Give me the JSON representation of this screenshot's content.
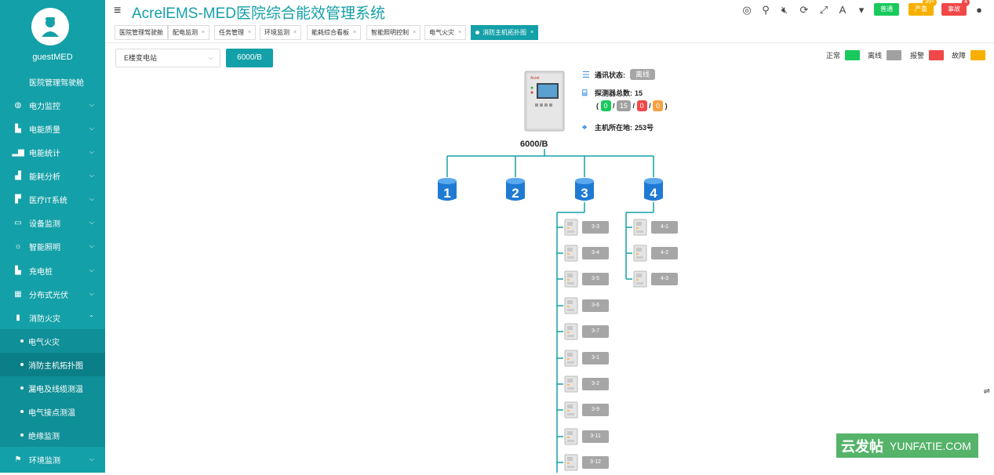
{
  "sidebar": {
    "username": "guestMED",
    "top_item": "医院管理驾驶舱",
    "items": [
      {
        "label": "电力监控",
        "icon": "globe-icon"
      },
      {
        "label": "电能质量",
        "icon": "building-icon"
      },
      {
        "label": "电能统计",
        "icon": "bar-chart-icon"
      },
      {
        "label": "能耗分析",
        "icon": "area-chart-icon"
      },
      {
        "label": "医疗IT系统",
        "icon": "hospital-icon"
      },
      {
        "label": "设备监测",
        "icon": "monitor-icon"
      },
      {
        "label": "智能照明",
        "icon": "bulb-icon"
      },
      {
        "label": "充电桩",
        "icon": "charger-icon"
      },
      {
        "label": "分布式光伏",
        "icon": "grid-icon"
      },
      {
        "label": "消防火灾",
        "icon": "extinguisher-icon"
      }
    ],
    "subitems": [
      "电气火灾",
      "消防主机拓扑图",
      "漏电及线缆测温",
      "电气接点测温",
      "绝缘监测"
    ],
    "last_item": {
      "label": "环境监测",
      "icon": "flag-icon"
    }
  },
  "header": {
    "title": "AcrelEMS-MED医院综合能效管理系统",
    "btn_normal": "普通",
    "btn_serious": "严重",
    "btn_serious_count": "99+",
    "btn_accident": "事故",
    "btn_accident_count": "4"
  },
  "tabs": [
    {
      "label": "医院管理驾驶舱",
      "closable": false
    },
    {
      "label": "配电监测",
      "closable": true
    },
    {
      "label": "任务管理",
      "closable": true
    },
    {
      "label": "环境监测",
      "closable": true
    },
    {
      "label": "能耗综合看板",
      "closable": true
    },
    {
      "label": "智能照明控制",
      "closable": true
    },
    {
      "label": "电气火灾",
      "closable": true
    },
    {
      "label": "消防主机拓扑图",
      "closable": true
    }
  ],
  "station": {
    "selected": "E楼变电站"
  },
  "device_button": "6000/B",
  "legend": [
    {
      "label": "正常",
      "color": "#19c95e"
    },
    {
      "label": "离线",
      "color": "#a0a0a0"
    },
    {
      "label": "报警",
      "color": "#f04848"
    },
    {
      "label": "故障",
      "color": "#f7b000"
    }
  ],
  "host": {
    "name": "6000/B",
    "comm_label": "通讯状态:",
    "comm_value": "离线",
    "detector_label": "探测器总数:",
    "detector_total": "15",
    "counts": {
      "normal": "0",
      "offline": "15",
      "alarm": "0",
      "fault": "0"
    },
    "location_label": "主机所在地:",
    "location_value": "253号"
  },
  "buses": [
    "1",
    "2",
    "3",
    "4"
  ],
  "bus3_devices": [
    "3-3",
    "3-4",
    "3-5",
    "3-6",
    "3-7",
    "3-1",
    "3-2",
    "3-9",
    "3-11",
    "3-12"
  ],
  "bus4_devices": [
    "4-1",
    "4-2",
    "4-3"
  ],
  "watermark": {
    "cn": "云发帖",
    "en": "YUNFATIE.COM"
  }
}
